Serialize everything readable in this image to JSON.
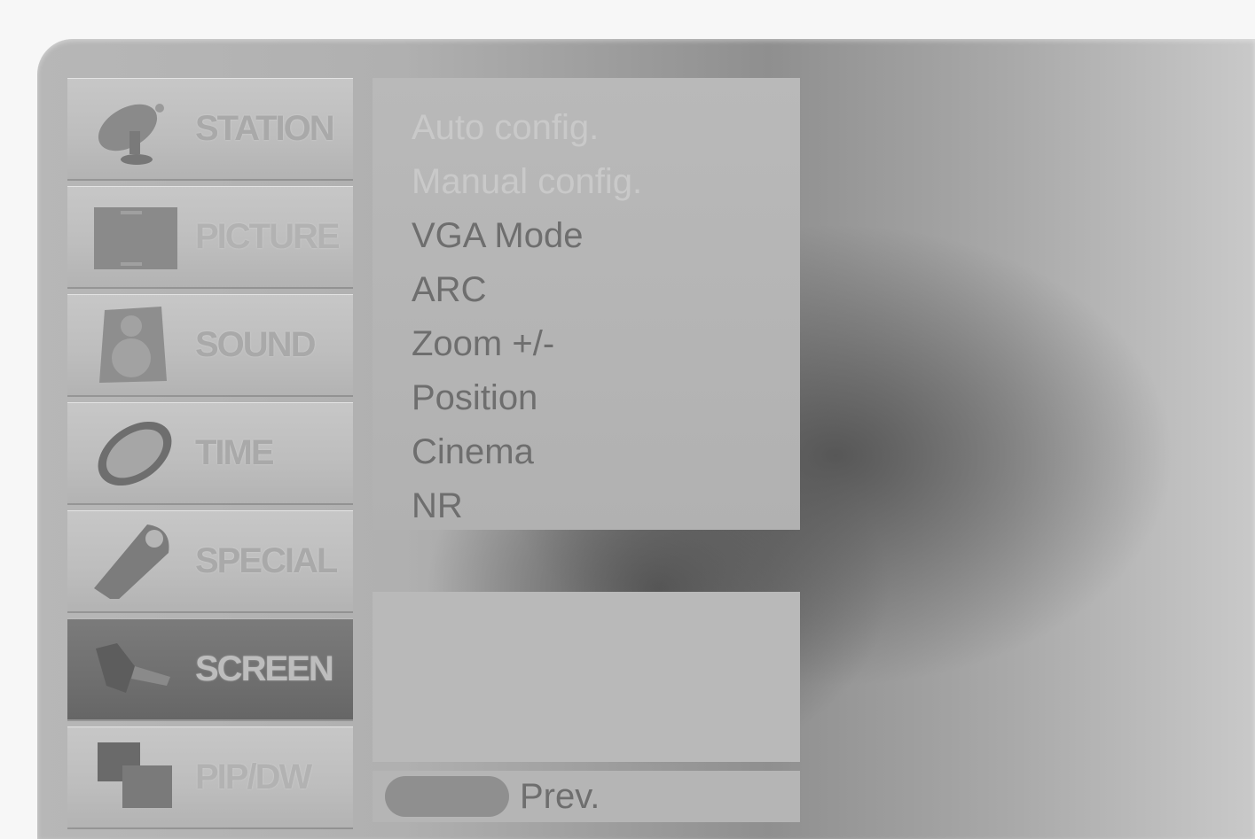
{
  "menu": {
    "items": [
      {
        "label": "STATION",
        "icon": "satellite-dish-icon"
      },
      {
        "label": "PICTURE",
        "icon": "picture-tv-icon"
      },
      {
        "label": "SOUND",
        "icon": "speaker-icon"
      },
      {
        "label": "TIME",
        "icon": "clock-icon"
      },
      {
        "label": "SPECIAL",
        "icon": "key-tag-icon"
      },
      {
        "label": "SCREEN",
        "icon": "screen-tools-icon",
        "selected": true
      },
      {
        "label": "PIP/DW",
        "icon": "pip-windows-icon"
      }
    ]
  },
  "submenu": {
    "items": [
      {
        "label": "Auto config."
      },
      {
        "label": "Manual config."
      },
      {
        "label": "VGA Mode"
      },
      {
        "label": "ARC"
      },
      {
        "label": "Zoom +/-"
      },
      {
        "label": "Position"
      },
      {
        "label": "Cinema"
      },
      {
        "label": "NR"
      }
    ]
  },
  "footer": {
    "prev_label": "Prev."
  },
  "colors": {
    "panel": "#b9b9b9",
    "selected_item": "#6f6f6f",
    "text": "#6e6e6e",
    "dim_text": "#c9c9c9"
  }
}
